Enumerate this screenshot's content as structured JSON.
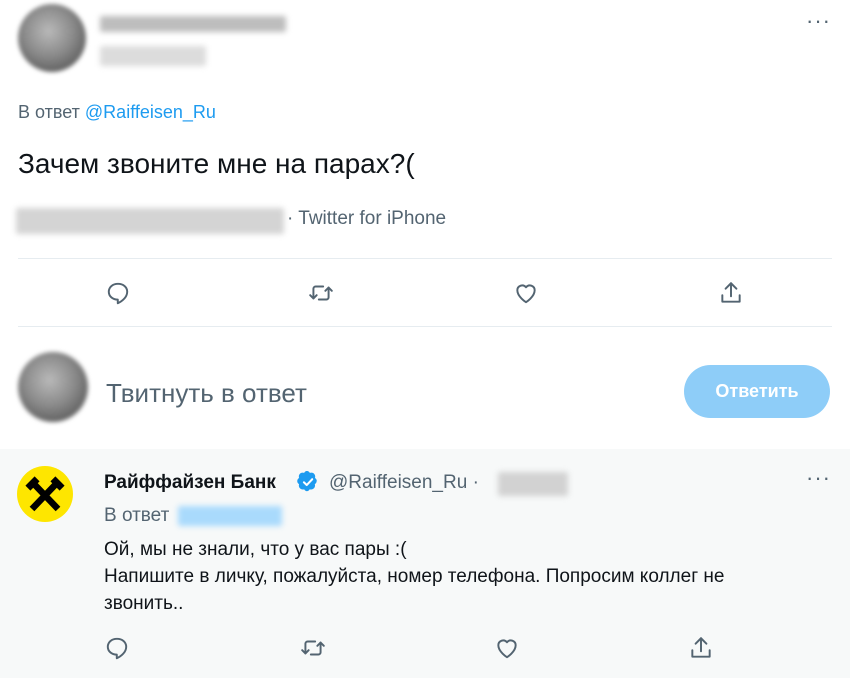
{
  "tweet": {
    "reply_prefix": "В ответ",
    "reply_mention": "@Raiffeisen_Ru",
    "text": "Зачем звоните мне на парах?(",
    "source": "· Twitter for iPhone",
    "more_label": "···"
  },
  "actions": {
    "reply_icon": "reply-icon",
    "retweet_icon": "retweet-icon",
    "like_icon": "heart-icon",
    "share_icon": "share-icon"
  },
  "compose": {
    "placeholder": "Твитнуть в ответ",
    "button_label": "Ответить"
  },
  "reply": {
    "author_name": "Райффайзен Банк",
    "author_handle": "@Raiffeisen_Ru ·",
    "reply_prefix": "В ответ",
    "lines": [
      "Ой, мы не знали, что у вас пары :(",
      "Напишите в личку, пожалуйста, номер телефона. Попросим коллег не",
      "звонить.."
    ],
    "more_label": "···"
  },
  "colors": {
    "accent": "#1d9bf0",
    "muted": "#536471",
    "button_disabled": "#8ecdf8",
    "brand_yellow": "#fee600"
  }
}
